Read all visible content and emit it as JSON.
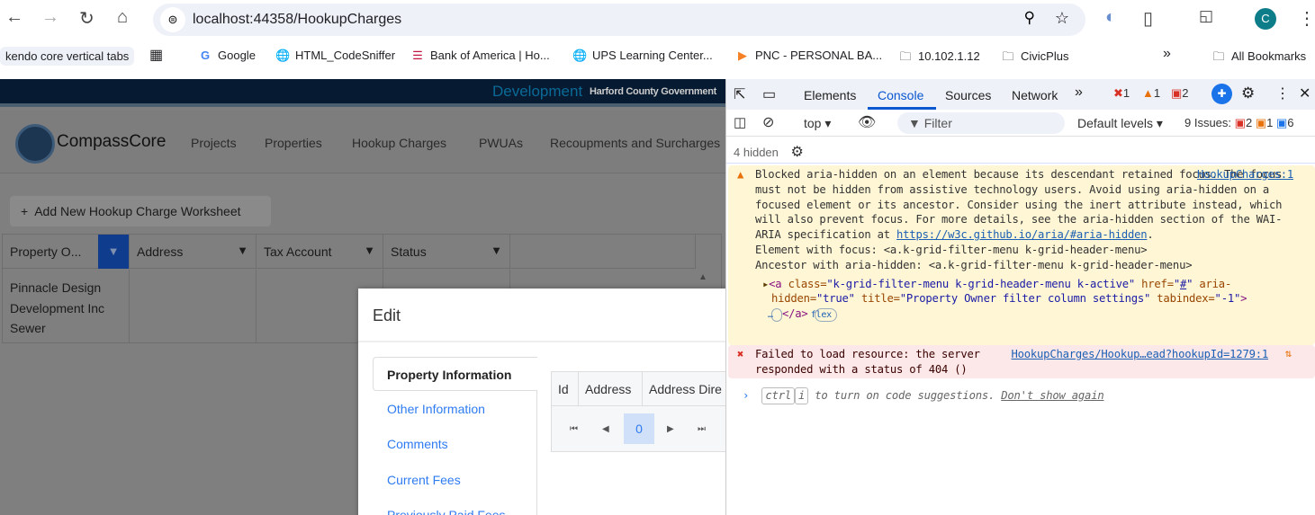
{
  "browser": {
    "url": "localhost:44358/HookupCharges",
    "bookmarks": [
      "kendo core vertical tabs",
      "Google",
      "HTML_CodeSniffer",
      "Bank of America | Ho...",
      "UPS Learning Center...",
      "PNC - PERSONAL BA...",
      "10.102.1.12",
      "CivicPlus"
    ],
    "all_bookmarks": "All Bookmarks",
    "profile_initial": "C"
  },
  "page": {
    "env_label": "Development",
    "org_label": "Harford County Government",
    "brand": "CompassCore",
    "nav": [
      "Projects",
      "Properties",
      "Hookup Charges",
      "PWUAs",
      "Recoupments and Surcharges"
    ],
    "add_button": "Add New Hookup Charge Worksheet",
    "grid": {
      "columns": [
        "Property O...",
        "Address",
        "Tax Account",
        "Status"
      ],
      "rows": [
        {
          "owner": "Pinnacle Design Development Inc Sewer"
        }
      ]
    },
    "modal": {
      "title": "Edit",
      "tabs": [
        "Property Information",
        "Other Information",
        "Comments",
        "Current Fees",
        "Previously Paid Fees"
      ],
      "active_tab": "Property Information",
      "inner_columns": [
        "Id",
        "Address",
        "Address Dire"
      ],
      "current_page": "0"
    }
  },
  "devtools": {
    "tabs": [
      "Elements",
      "Console",
      "Sources",
      "Network"
    ],
    "active_tab": "Console",
    "counts": {
      "errors": "1",
      "warnings": "1",
      "issues_err": "2"
    },
    "context": "top",
    "filter_placeholder": "Filter",
    "levels": "Default levels",
    "issues_label": "9 Issues:",
    "issues": {
      "error": "2",
      "warning": "1",
      "info": "6"
    },
    "hidden": "4 hidden",
    "messages": [
      {
        "level": "warning",
        "source": "HookupCharges:1",
        "text": "Blocked aria-hidden on an element because its descendant retained focus. The focus must not be hidden from assistive technology users. Avoid using aria-hidden on a focused element or its ancestor. Consider using the inert attribute instead, which will also prevent focus. For more details, see the aria-hidden section of the WAI-ARIA specification at",
        "link": "https://w3c.github.io/aria/#aria-hidden",
        "focus_line": "Element with focus: <a.k-grid-filter-menu k-grid-header-menu>",
        "ancestor_line": "Ancestor with aria-hidden: <a.k-grid-filter-menu k-grid-header-menu>",
        "node": {
          "class": "k-grid-filter-menu k-grid-header-menu k-active",
          "href": "#",
          "aria_hidden": "true",
          "title": "Property Owner filter column settings",
          "tabindex": "-1",
          "badge": "flex"
        }
      },
      {
        "level": "error",
        "source": "HookupCharges/Hookup…ead?hookupId=1279:1",
        "text": "Failed to load resource: the server responded with a status of 404 ()"
      }
    ],
    "prompt": {
      "key1": "ctrl",
      "key2": "i",
      "text": "to turn on code suggestions.",
      "dismiss": "Don't show again"
    }
  }
}
